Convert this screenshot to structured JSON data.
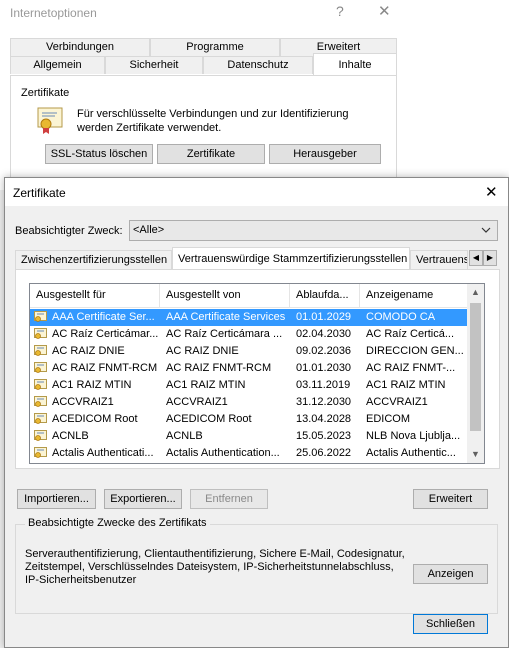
{
  "back_window": {
    "title": "Internetoptionen",
    "help_glyph": "?",
    "close_glyph": "✕",
    "tabs_row1": [
      "Verbindungen",
      "Programme",
      "Erweitert"
    ],
    "tabs_row2": [
      "Allgemein",
      "Sicherheit",
      "Datenschutz",
      "Inhalte"
    ],
    "section_title": "Zertifikate",
    "description": "Für verschlüsselte Verbindungen und zur Identifizierung werden Zertifikate verwendet.",
    "buttons": {
      "ssl": "SSL-Status löschen",
      "certificates": "Zertifikate",
      "publisher": "Herausgeber"
    }
  },
  "dialog": {
    "title": "Zertifikate",
    "close_glyph": "✕",
    "purpose_label": "Beabsichtigter Zweck:",
    "purpose_value": "<Alle>",
    "tabs": [
      "Zwischenzertifizierungsstellen",
      "Vertrauenswürdige Stammzertifizierungsstellen",
      "Vertrauens"
    ],
    "columns": [
      "Ausgestellt für",
      "Ausgestellt von",
      "Ablaufda...",
      "Anzeigename"
    ],
    "rows": [
      [
        "AAA Certificate Ser...",
        "AAA Certificate Services",
        "01.01.2029",
        "COMODO CA"
      ],
      [
        "AC Raíz Certicámar...",
        "AC Raíz Certicámara ...",
        "02.04.2030",
        "AC Raíz Certicá..."
      ],
      [
        "AC RAIZ DNIE",
        "AC RAIZ DNIE",
        "09.02.2036",
        "DIRECCION GEN..."
      ],
      [
        "AC RAIZ FNMT-RCM",
        "AC RAIZ FNMT-RCM",
        "01.01.2030",
        "AC RAIZ FNMT-..."
      ],
      [
        "AC1 RAIZ MTIN",
        "AC1 RAIZ MTIN",
        "03.11.2019",
        "AC1 RAIZ MTIN"
      ],
      [
        "ACCVRAIZ1",
        "ACCVRAIZ1",
        "31.12.2030",
        "ACCVRAIZ1"
      ],
      [
        "ACEDICOM Root",
        "ACEDICOM Root",
        "13.04.2028",
        "EDICOM"
      ],
      [
        "ACNLB",
        "ACNLB",
        "15.05.2023",
        "NLB Nova Ljublja..."
      ],
      [
        "Actalis Authenticati...",
        "Actalis Authentication...",
        "25.06.2022",
        "Actalis Authentic..."
      ]
    ],
    "buttons": {
      "import": "Importieren...",
      "export": "Exportieren...",
      "remove": "Entfernen",
      "advanced": "Erweitert",
      "view": "Anzeigen",
      "close": "Schließen"
    },
    "purposes_title": "Beabsichtigte Zwecke des Zertifikats",
    "purposes_text": "Serverauthentifizierung, Clientauthentifizierung, Sichere E-Mail, Codesignatur, Zeitstempel, Verschlüsselndes Dateisystem, IP-Sicherheitstunnelabschluss, IP-Sicherheitsbenutzer"
  },
  "colors": {
    "selection": "#3399ff",
    "focus_border": "#0078d7",
    "button_bg": "#e1e1e1"
  }
}
